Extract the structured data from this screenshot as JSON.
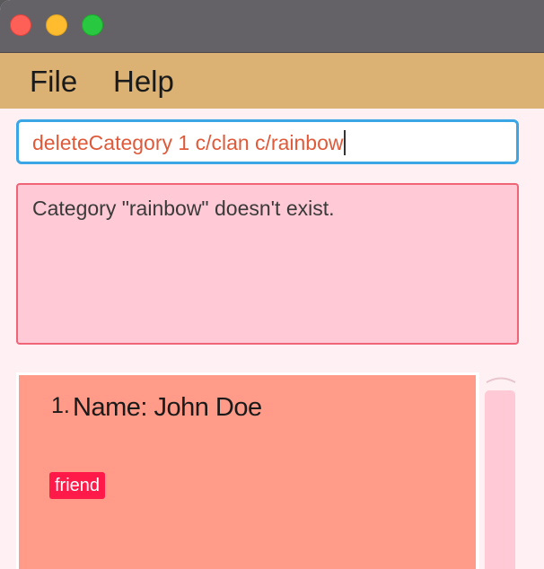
{
  "window": {
    "controls": {
      "close": "close",
      "minimize": "minimize",
      "maximize": "maximize"
    },
    "colors": {
      "titlebar": "#656267",
      "menubar": "#dbb273",
      "background": "#fff0f3"
    }
  },
  "menu": {
    "file": "File",
    "help": "Help"
  },
  "command": {
    "value": "deleteCategory 1 c/clan c/rainbow"
  },
  "result": {
    "message": "Category \"rainbow\" doesn't exist."
  },
  "persons": [
    {
      "index": "1.",
      "name": "Name: John Doe",
      "tags": [
        "friend"
      ]
    }
  ],
  "scrollbar": {
    "arrow_icon": "chevron-up-icon"
  }
}
